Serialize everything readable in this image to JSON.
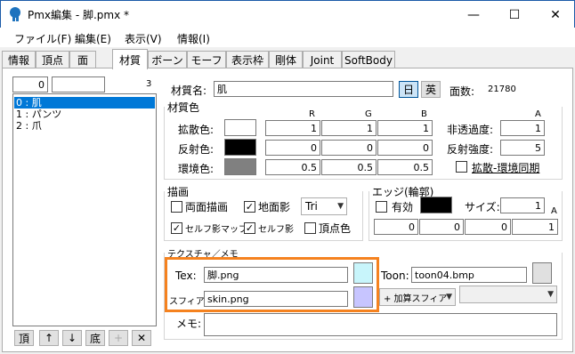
{
  "window": {
    "title": "Pmx編集 - 脚.pmx *",
    "minimize": "—",
    "maximize": "☐",
    "close": "✕"
  },
  "menu": [
    "ファイル(F)",
    "編集(E)",
    "表示(V)",
    "情報(I)"
  ],
  "tabs": [
    "情報",
    "頂点",
    "面",
    "材質",
    "ボーン",
    "モーフ",
    "表示枠",
    "剛体",
    "Joint",
    "SoftBody"
  ],
  "active_tab": "材質",
  "left": {
    "index_value": "0",
    "filter_value": "",
    "count": "3",
    "materials": [
      "0 : 肌",
      "1 : パンツ",
      "2 : 爪"
    ],
    "buttons": {
      "top": "頂",
      "up": "↑",
      "down": "↓",
      "bottom": "底",
      "add": "+",
      "remove": "✕"
    }
  },
  "material": {
    "name_label": "材質名:",
    "name_value": "肌",
    "lang_jp": "日",
    "lang_en": "英",
    "face_count_label": "面数:",
    "face_count_value": "21780",
    "color_section": "材質色",
    "col_r": "R",
    "col_g": "G",
    "col_b": "B",
    "col_a": "A",
    "diffuse_label": "拡散色:",
    "diffuse": [
      "1",
      "1",
      "1"
    ],
    "diffuse_color": "#ffffff",
    "specular_label": "反射色:",
    "specular": [
      "0",
      "0",
      "0"
    ],
    "specular_color": "#000000",
    "ambient_label": "環境色:",
    "ambient": [
      "0.5",
      "0.5",
      "0.5"
    ],
    "ambient_color": "#808080",
    "alpha_label": "非透過度:",
    "alpha_value": "1",
    "spec_power_label": "反射強度:",
    "spec_power_value": "5",
    "sync_label": "拡散-環境同期",
    "sync_checked": false
  },
  "draw": {
    "section": "描画",
    "double_sided": "両面描画",
    "double_sided_checked": false,
    "ground_shadow": "地面影",
    "ground_shadow_checked": true,
    "primitive_value": "Tri",
    "self_shadow_map": "セルフ影マップ",
    "self_shadow_map_checked": true,
    "self_shadow": "セルフ影",
    "self_shadow_checked": true,
    "vertex_color": "頂点色",
    "vertex_color_checked": false
  },
  "edge": {
    "section": "エッジ(輪郭)",
    "enabled_label": "有効",
    "enabled_checked": false,
    "color": "#000000",
    "size_label": "サイズ:",
    "size_value": "1",
    "a_label": "A",
    "rgba": [
      "0",
      "0",
      "0",
      "1"
    ]
  },
  "texture": {
    "section": "テクスチャ／メモ",
    "tex_label": "Tex:",
    "tex_value": "脚.png",
    "tex_color": "#c8f5fb",
    "sphere_label": "スフィア:",
    "sphere_value": "skin.png",
    "sphere_color": "#c7c5ff",
    "toon_label": "Toon:",
    "toon_value": "toon04.bmp",
    "toon_color": "#e0e0e0",
    "sphere_mode": "+ 加算スフィア",
    "memo_label": "メモ:",
    "memo_value": "",
    "highlight_color": "#f5821f"
  }
}
